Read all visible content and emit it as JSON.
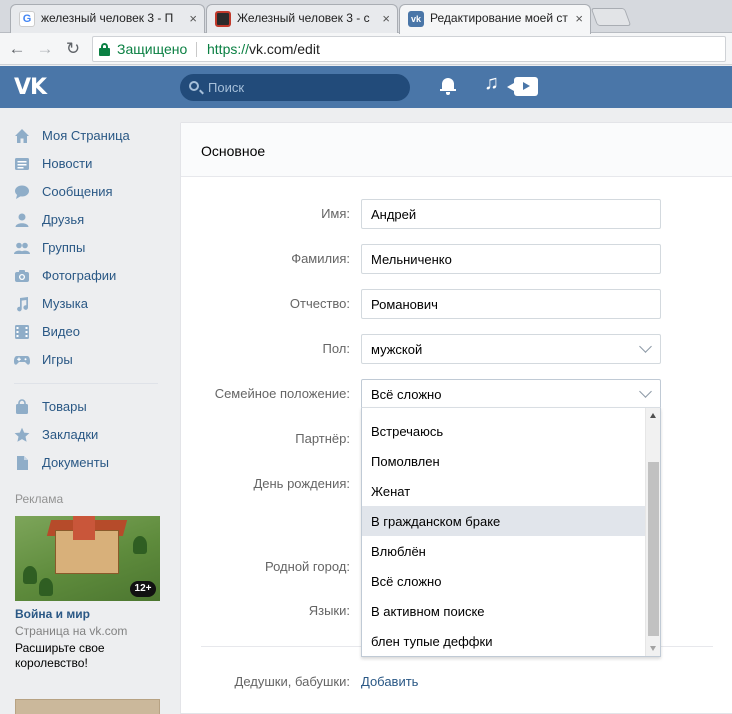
{
  "browser": {
    "tabs": [
      {
        "title": "железный человек 3 - П",
        "favicon": "google-favicon",
        "active": false
      },
      {
        "title": "Железный человек 3 - с",
        "favicon": "iron-favicon",
        "active": false
      },
      {
        "title": "Редактирование моей ст",
        "favicon": "vk-favicon",
        "active": true
      }
    ],
    "close_glyph": "×",
    "secure_label": "Защищено",
    "url_scheme": "https://",
    "url_host": "vk.com",
    "url_path": "/edit"
  },
  "header": {
    "logo": "VK",
    "search_placeholder": "Поиск",
    "accent_color": "#4a76a8"
  },
  "sidebar": {
    "items": [
      {
        "label": "Моя Страница",
        "icon": "home-icon"
      },
      {
        "label": "Новости",
        "icon": "news-icon"
      },
      {
        "label": "Сообщения",
        "icon": "messages-icon"
      },
      {
        "label": "Друзья",
        "icon": "friend-icon"
      },
      {
        "label": "Группы",
        "icon": "groups-icon"
      },
      {
        "label": "Фотографии",
        "icon": "camera-icon"
      },
      {
        "label": "Музыка",
        "icon": "music-icon"
      },
      {
        "label": "Видео",
        "icon": "video-icon"
      },
      {
        "label": "Игры",
        "icon": "gamepad-icon"
      }
    ],
    "items2": [
      {
        "label": "Товары",
        "icon": "bag-icon"
      },
      {
        "label": "Закладки",
        "icon": "star-icon"
      },
      {
        "label": "Документы",
        "icon": "document-icon"
      }
    ],
    "ads_label": "Реклама",
    "ad": {
      "badge": "12+",
      "title": "Война и мир",
      "subtitle": "Страница на vk.com",
      "description": "Расширьте свое королевство!"
    }
  },
  "main": {
    "section_title": "Основное",
    "fields": {
      "first_name": {
        "label": "Имя:",
        "value": "Андрей"
      },
      "last_name": {
        "label": "Фамилия:",
        "value": "Мельниченко"
      },
      "patronymic": {
        "label": "Отчество:",
        "value": "Романович"
      },
      "gender": {
        "label": "Пол:",
        "value": "мужской"
      },
      "relationship": {
        "label": "Семейное положение:",
        "value": "Всё сложно"
      },
      "partner": {
        "label": "Партнёр:"
      },
      "birthday": {
        "label": "День рождения:"
      },
      "hometown": {
        "label": "Родной город:"
      },
      "languages": {
        "label": "Языки:"
      },
      "grandparents": {
        "label": "Дедушки, бабушки:",
        "link": "Добавить"
      }
    },
    "relationship_options": [
      "Встречаюсь",
      "Помолвлен",
      "Женат",
      "В гражданском браке",
      "Влюблён",
      "Всё сложно",
      "В активном поиске",
      "блен тупые деффки"
    ],
    "hovered_option": "В гражданском браке"
  }
}
